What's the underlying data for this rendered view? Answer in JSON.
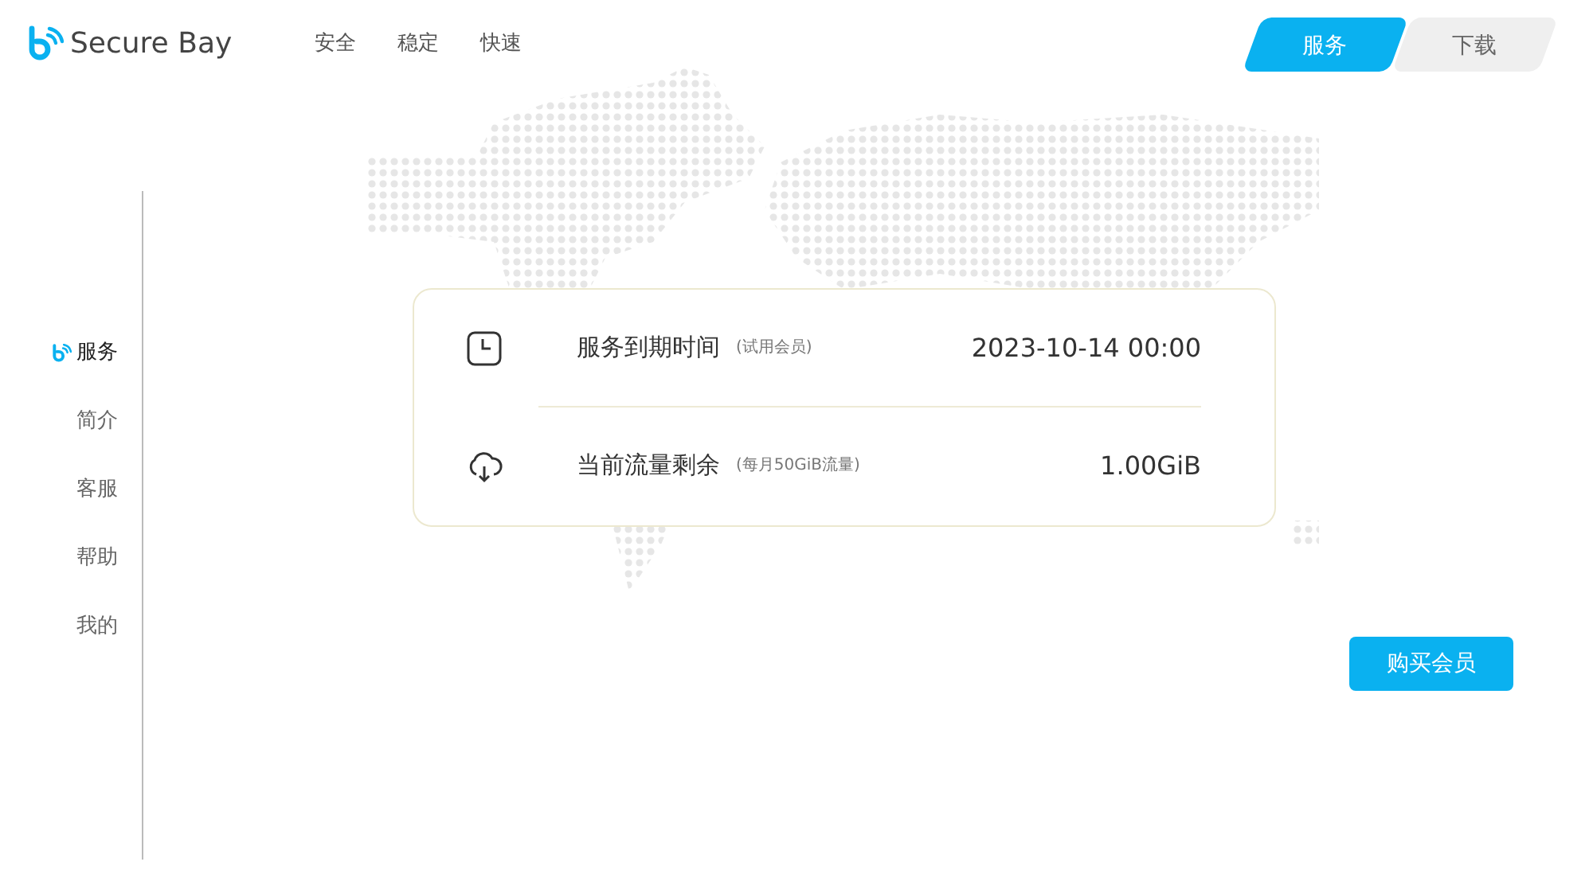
{
  "brand": "Secure Bay",
  "nav": [
    "安全",
    "稳定",
    "快速"
  ],
  "tabs": [
    {
      "label": "服务",
      "selected": true
    },
    {
      "label": "下载",
      "selected": false
    }
  ],
  "sidebar": {
    "items": [
      {
        "label": "服务",
        "selected": true
      },
      {
        "label": "简介",
        "selected": false
      },
      {
        "label": "客服",
        "selected": false
      },
      {
        "label": "帮助",
        "selected": false
      },
      {
        "label": "我的",
        "selected": false
      }
    ]
  },
  "info": [
    {
      "kind": "clock",
      "label": "服务到期时间",
      "note": "(试用会员)",
      "value": "2023-10-14 00:00"
    },
    {
      "kind": "cloud",
      "label": "当前流量剩余",
      "note": "(每月50GiB流量)",
      "value": "1.00GiB"
    }
  ],
  "buy_button": "购买会员"
}
